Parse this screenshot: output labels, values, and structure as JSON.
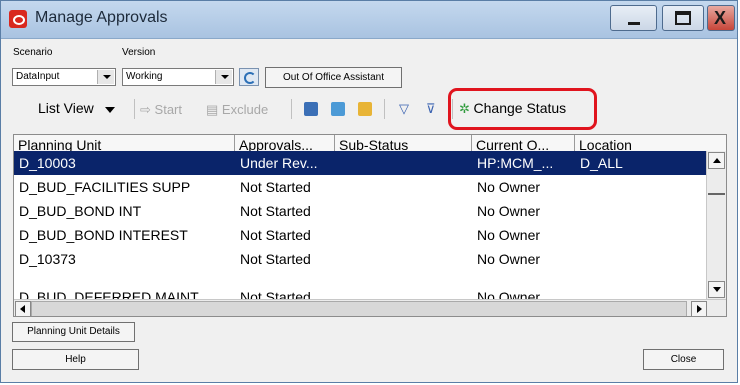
{
  "window": {
    "title": "Manage Approvals"
  },
  "filters": {
    "scenario_label": "Scenario",
    "version_label": "Version",
    "scenario_value": "DataInput",
    "version_value": "Working",
    "out_of_office_label": "Out Of Office Assistant"
  },
  "toolbar": {
    "list_view_label": "List View",
    "start_label": "Start",
    "exclude_label": "Exclude",
    "change_status_label": "Change Status"
  },
  "grid": {
    "columns": [
      "Planning Unit",
      "Approvals...",
      "Sub-Status",
      "Current O...",
      "Location"
    ],
    "rows": [
      [
        "D_10003",
        "Under Rev...",
        "",
        "HP:MCM_...",
        "D_ALL"
      ],
      [
        "D_BUD_FACILITIES SUPP",
        "Not Started",
        "",
        "No Owner",
        ""
      ],
      [
        "D_BUD_BOND INT",
        "Not Started",
        "",
        "No Owner",
        ""
      ],
      [
        "D_BUD_BOND INTEREST",
        "Not Started",
        "",
        "No Owner",
        ""
      ],
      [
        "D_10373",
        "Not Started",
        "",
        "No Owner",
        ""
      ],
      [
        "D_BUD_DEFERRED MAINT",
        "Not Started",
        "",
        "No Owner",
        ""
      ]
    ]
  },
  "footer": {
    "planning_unit_details_label": "Planning Unit Details",
    "help_label": "Help",
    "close_label": "Close"
  }
}
